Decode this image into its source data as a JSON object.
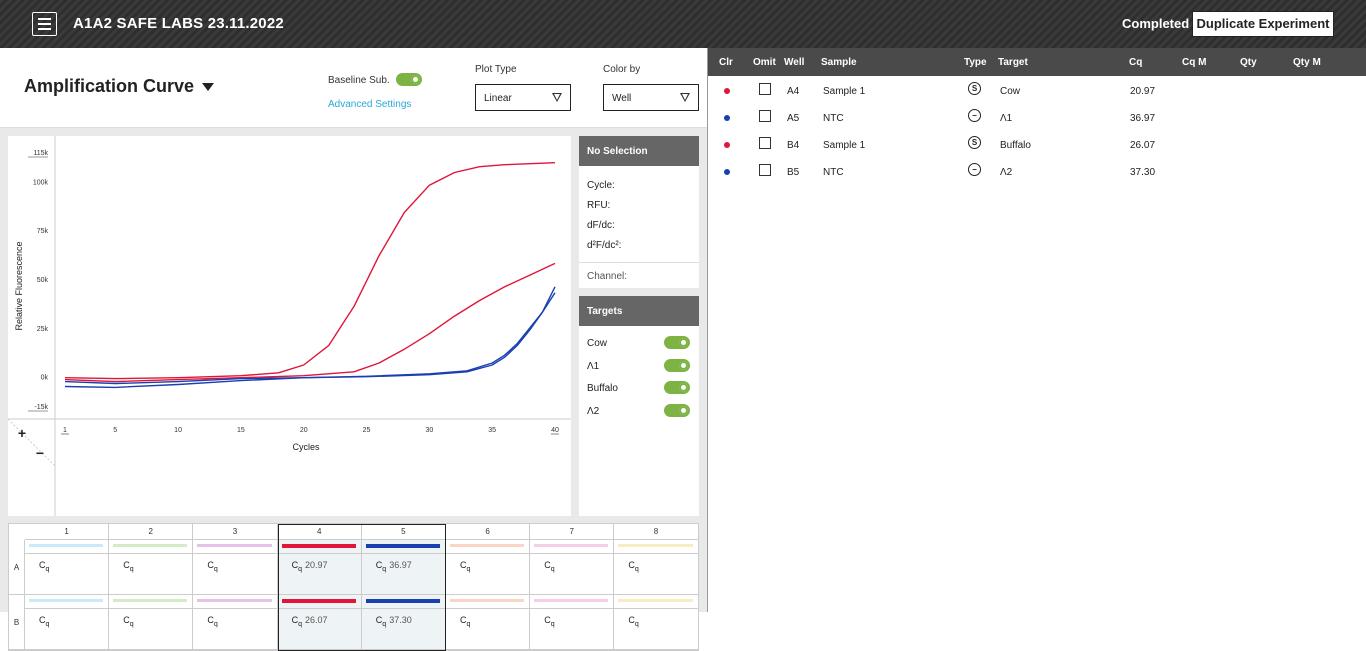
{
  "header": {
    "title": "A1A2 SAFE LABS 23.11.2022",
    "status": "Completed",
    "duplicate_label": "Duplicate Experiment"
  },
  "controls": {
    "plot_title": "Amplification Curve",
    "baseline_label": "Baseline Sub.",
    "advanced_label": "Advanced Settings",
    "plot_type_label": "Plot Type",
    "plot_type_value": "Linear",
    "color_by_label": "Color by",
    "color_by_value": "Well"
  },
  "chart_data": {
    "type": "line",
    "xlabel": "Cycles",
    "ylabel": "Relative Fluorescence",
    "xlim": [
      1,
      40
    ],
    "ylim": [
      -15000,
      115000
    ],
    "x_ticks": [
      "1",
      "5",
      "10",
      "15",
      "20",
      "25",
      "30",
      "35",
      "40"
    ],
    "y_ticks": [
      "115k",
      "100k",
      "75k",
      "50k",
      "25k",
      "0k",
      "-15k"
    ],
    "series": [
      {
        "well": "A4",
        "color": "#e0153a",
        "points": [
          [
            1,
            -500
          ],
          [
            5,
            -1000
          ],
          [
            10,
            -500
          ],
          [
            15,
            500
          ],
          [
            18,
            2000
          ],
          [
            20,
            6000
          ],
          [
            22,
            16000
          ],
          [
            24,
            36000
          ],
          [
            26,
            62000
          ],
          [
            28,
            84000
          ],
          [
            30,
            98000
          ],
          [
            32,
            104500
          ],
          [
            34,
            107500
          ],
          [
            36,
            108500
          ],
          [
            38,
            109000
          ],
          [
            40,
            109500
          ]
        ]
      },
      {
        "well": "B4",
        "color": "#e0153a",
        "points": [
          [
            1,
            -1500
          ],
          [
            5,
            -2500
          ],
          [
            10,
            -1500
          ],
          [
            15,
            -500
          ],
          [
            20,
            500
          ],
          [
            24,
            2500
          ],
          [
            26,
            7000
          ],
          [
            28,
            14000
          ],
          [
            30,
            22000
          ],
          [
            32,
            31000
          ],
          [
            34,
            39000
          ],
          [
            36,
            46000
          ],
          [
            38,
            52000
          ],
          [
            40,
            58000
          ]
        ]
      },
      {
        "well": "A5",
        "color": "#1a3fb0",
        "points": [
          [
            1,
            -5000
          ],
          [
            5,
            -5500
          ],
          [
            10,
            -4000
          ],
          [
            15,
            -2000
          ],
          [
            20,
            -500
          ],
          [
            25,
            0
          ],
          [
            30,
            1000
          ],
          [
            33,
            2500
          ],
          [
            35,
            6000
          ],
          [
            36,
            10000
          ],
          [
            37,
            16000
          ],
          [
            38,
            24000
          ],
          [
            39,
            33000
          ],
          [
            40,
            46000
          ]
        ]
      },
      {
        "well": "B5",
        "color": "#1a3fb0",
        "points": [
          [
            1,
            -2500
          ],
          [
            5,
            -3500
          ],
          [
            10,
            -2500
          ],
          [
            15,
            -1000
          ],
          [
            20,
            -500
          ],
          [
            25,
            200
          ],
          [
            30,
            1500
          ],
          [
            33,
            3000
          ],
          [
            35,
            7000
          ],
          [
            36,
            11000
          ],
          [
            37,
            17000
          ],
          [
            38,
            25000
          ],
          [
            39,
            33000
          ],
          [
            40,
            43000
          ]
        ]
      }
    ]
  },
  "selection": {
    "title": "No Selection",
    "cycle": "Cycle:",
    "rfu": "RFU:",
    "df": "dF/dc:",
    "d2f": "d²F/dc²:",
    "channel": "Channel:"
  },
  "targets": {
    "title": "Targets",
    "items": [
      {
        "label": "Cow"
      },
      {
        "label": "Λ1"
      },
      {
        "label": "Buffalo"
      },
      {
        "label": "Λ2"
      }
    ]
  },
  "plate": {
    "columns": [
      "1",
      "2",
      "3",
      "4",
      "5",
      "6",
      "7",
      "8"
    ],
    "rows": [
      "A",
      "B"
    ],
    "col_colors": [
      "#cce9f7",
      "#d4ecc6",
      "#e6c3e6",
      "#e0153a",
      "#1a3fb0",
      "#f8d5c4",
      "#f5cfe8",
      "#f8ecc2"
    ],
    "cq_label": "Cq",
    "values": {
      "A": [
        "",
        "",
        "",
        "20.97",
        "36.97",
        "",
        "",
        ""
      ],
      "B": [
        "",
        "",
        "",
        "26.07",
        "37.30",
        "",
        "",
        ""
      ]
    }
  },
  "table": {
    "headers": {
      "clr": "Clr",
      "omit": "Omit",
      "well": "Well",
      "sample": "Sample",
      "type": "Type",
      "target": "Target",
      "cq": "Cq",
      "cqm": "Cq M",
      "qty": "Qty",
      "qtym": "Qty M"
    },
    "rows": [
      {
        "color": "#e0153a",
        "well": "A4",
        "sample": "Sample 1",
        "type": "S",
        "target": "Cow",
        "cq": "20.97"
      },
      {
        "color": "#1a3fb0",
        "well": "A5",
        "sample": "NTC",
        "type": "−",
        "target": "Λ1",
        "cq": "36.97"
      },
      {
        "color": "#e0153a",
        "well": "B4",
        "sample": "Sample 1",
        "type": "S",
        "target": "Buffalo",
        "cq": "26.07"
      },
      {
        "color": "#1a3fb0",
        "well": "B5",
        "sample": "NTC",
        "type": "−",
        "target": "Λ2",
        "cq": "37.30"
      }
    ]
  }
}
